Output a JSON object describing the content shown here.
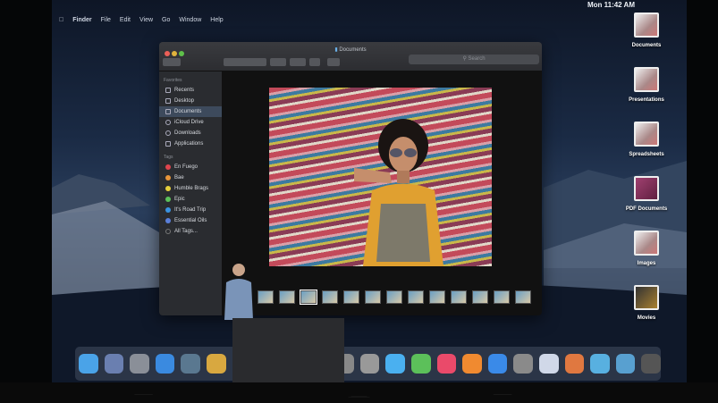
{
  "menubar": {
    "items": [
      "Finder",
      "File",
      "Edit",
      "View",
      "Go",
      "Window",
      "Help"
    ],
    "clock": "Mon 11:42 AM"
  },
  "finder": {
    "title": "Documents",
    "search_placeholder": "Search",
    "sidebar": {
      "favorites_label": "Favorites",
      "favorites": [
        {
          "label": "Recents",
          "selected": false
        },
        {
          "label": "Desktop",
          "selected": false
        },
        {
          "label": "Documents",
          "selected": true
        },
        {
          "label": "iCloud Drive",
          "selected": false
        },
        {
          "label": "Downloads",
          "selected": false
        },
        {
          "label": "Applications",
          "selected": false
        }
      ],
      "tags_label": "Tags",
      "tags": [
        {
          "label": "En Fuego",
          "color": "#e0454d"
        },
        {
          "label": "Bae",
          "color": "#e8963a"
        },
        {
          "label": "Humble Brags",
          "color": "#e5cf3c"
        },
        {
          "label": "Epic",
          "color": "#5cc15a"
        },
        {
          "label": "It's Road Trip",
          "color": "#3a92e0"
        },
        {
          "label": "Essential Oils",
          "color": "#5a7fd9"
        },
        {
          "label": "All Tags...",
          "color": "#777"
        }
      ]
    }
  },
  "desktop": {
    "items": [
      "Documents",
      "Presentations",
      "Spreadsheets",
      "PDF Documents",
      "Images",
      "Movies"
    ]
  },
  "dock": {
    "colors": [
      "#4aa3e8",
      "#6a7fb0",
      "#8a8f98",
      "#3a8ae0",
      "#5a7890",
      "#d8a840",
      "#c44",
      "#888",
      "#888",
      "#999",
      "#888",
      "#999",
      "#4ab0f0",
      "#5cc05a",
      "#ea4a6a",
      "#f08a30",
      "#3a8ae8",
      "#8a8a8a",
      "#d0d8e8",
      "#e07840",
      "#58b0e0",
      "#58a0d0",
      "#555"
    ]
  }
}
